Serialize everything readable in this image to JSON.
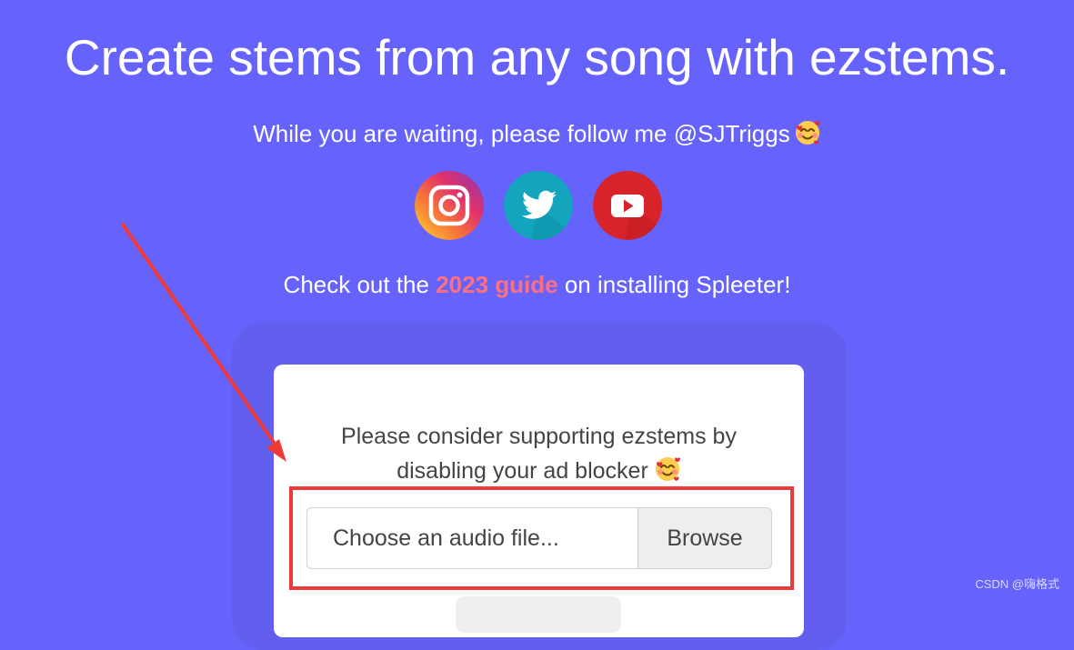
{
  "header": {
    "title": "Create stems from any song with ezstems.",
    "follow_text": "While you are waiting, please follow me @SJTriggs"
  },
  "social": [
    {
      "name": "Instagram",
      "icon": "instagram-icon"
    },
    {
      "name": "Twitter",
      "icon": "twitter-icon"
    },
    {
      "name": "YouTube",
      "icon": "youtube-icon"
    }
  ],
  "guide": {
    "prefix": "Check out the ",
    "link_text": "2023 guide",
    "suffix": " on installing Spleeter!"
  },
  "card": {
    "support_line1": "Please consider supporting ezstems by",
    "support_line2": "disabling your ad blocker",
    "file_input_placeholder": "Choose an audio file...",
    "browse_label": "Browse"
  },
  "watermark": "CSDN @嗨格式",
  "colors": {
    "background": "#6663fd",
    "guide_link": "#ff6f7d",
    "annotation": "#ef3a3a"
  }
}
